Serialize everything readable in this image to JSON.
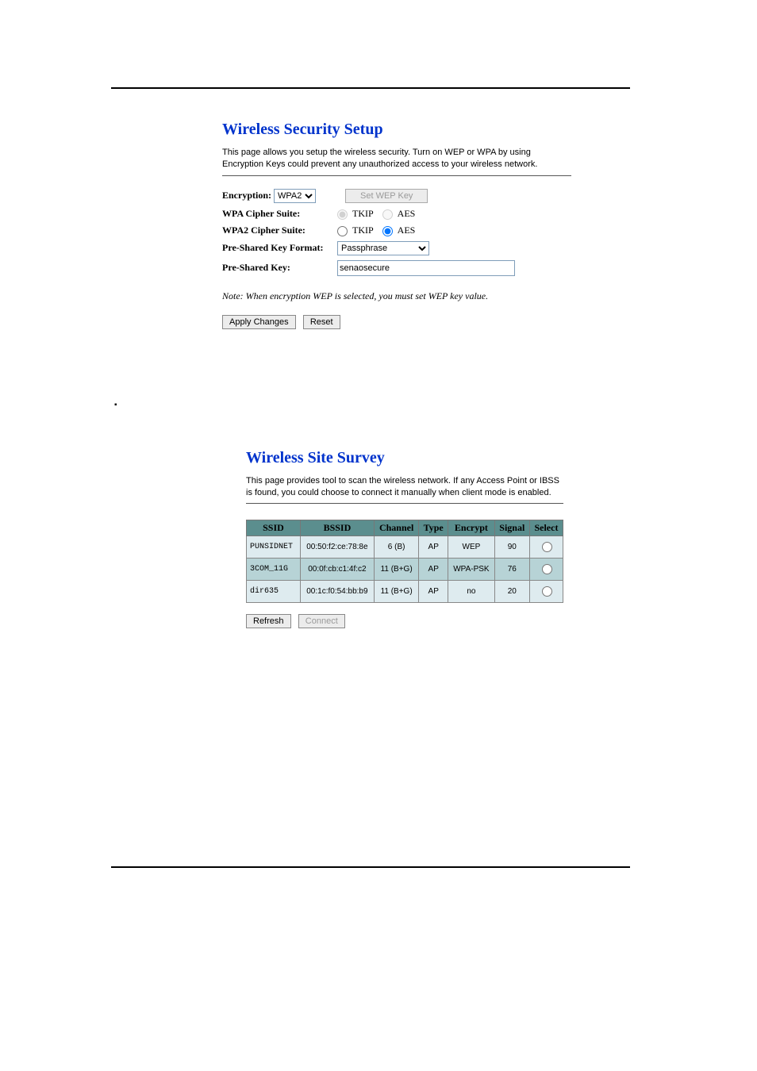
{
  "security": {
    "title": "Wireless Security Setup",
    "desc": "This page allows you setup the wireless security. Turn on WEP or WPA by using Encryption Keys could prevent any unauthorized access to your wireless network.",
    "labels": {
      "encryption": "Encryption:",
      "setwep": "Set WEP Key",
      "wpa_cipher": "WPA Cipher Suite:",
      "wpa2_cipher": "WPA2 Cipher Suite:",
      "psk_format": "Pre-Shared Key Format:",
      "psk": "Pre-Shared Key:"
    },
    "encryption_value": "WPA2",
    "cipher_opts": {
      "tkip": "TKIP",
      "aes": "AES"
    },
    "wpa_selected": "tkip",
    "wpa2_selected": "aes",
    "psk_format_value": "Passphrase",
    "psk_value": "senaosecure",
    "note": "Note: When encryption WEP is selected, you must set WEP key value.",
    "apply": "Apply Changes",
    "reset": "Reset"
  },
  "survey": {
    "title": "Wireless Site Survey",
    "desc": "This page provides tool to scan the wireless network. If any Access Point or IBSS is found, you could choose to connect it manually when client mode is enabled.",
    "headers": [
      "SSID",
      "BSSID",
      "Channel",
      "Type",
      "Encrypt",
      "Signal",
      "Select"
    ],
    "rows": [
      {
        "ssid": "PUNSIDNET",
        "bssid": "00:50:f2:ce:78:8e",
        "channel": "6 (B)",
        "type": "AP",
        "encrypt": "WEP",
        "signal": "90"
      },
      {
        "ssid": "3COM_11G",
        "bssid": "00:0f:cb:c1:4f:c2",
        "channel": "11 (B+G)",
        "type": "AP",
        "encrypt": "WPA-PSK",
        "signal": "76"
      },
      {
        "ssid": "dir635",
        "bssid": "00:1c:f0:54:bb:b9",
        "channel": "11 (B+G)",
        "type": "AP",
        "encrypt": "no",
        "signal": "20"
      }
    ],
    "refresh": "Refresh",
    "connect": "Connect"
  }
}
